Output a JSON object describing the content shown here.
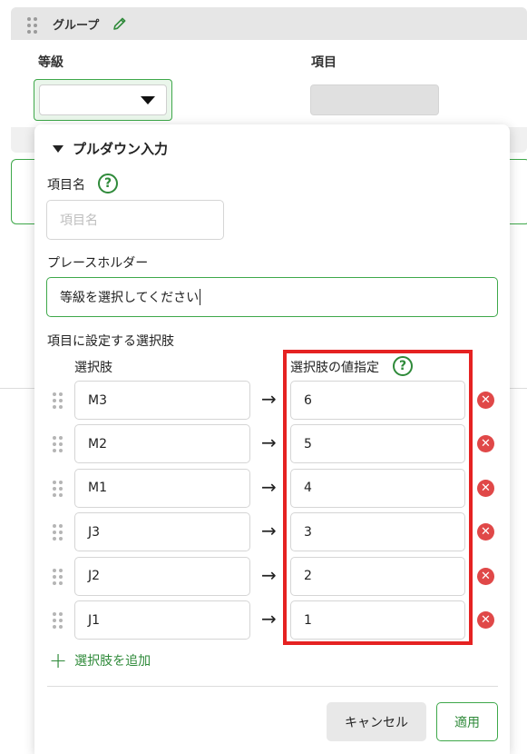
{
  "background": {
    "group_title": "グループ",
    "grade_label": "等級",
    "item_label": "項目"
  },
  "panel": {
    "title": "プルダウン入力",
    "item_name_label": "項目名",
    "item_name_placeholder": "項目名",
    "placeholder_label": "プレースホルダー",
    "placeholder_value": "等級を選択してください",
    "options_section_label": "項目に設定する選択肢",
    "choice_col_label": "選択肢",
    "value_col_label": "選択肢の値指定",
    "arrow_glyph": "→",
    "options": [
      {
        "choice": "M3",
        "value": "6"
      },
      {
        "choice": "M2",
        "value": "5"
      },
      {
        "choice": "M1",
        "value": "4"
      },
      {
        "choice": "J3",
        "value": "3"
      },
      {
        "choice": "J2",
        "value": "2"
      },
      {
        "choice": "J1",
        "value": "1"
      }
    ],
    "add_option_label": "選択肢を追加",
    "cancel_label": "キャンセル",
    "apply_label": "適用",
    "help_glyph": "?"
  },
  "colors": {
    "accent_green": "#2f8a3a",
    "highlight_red": "#e52222",
    "remove_red": "#e04848"
  }
}
